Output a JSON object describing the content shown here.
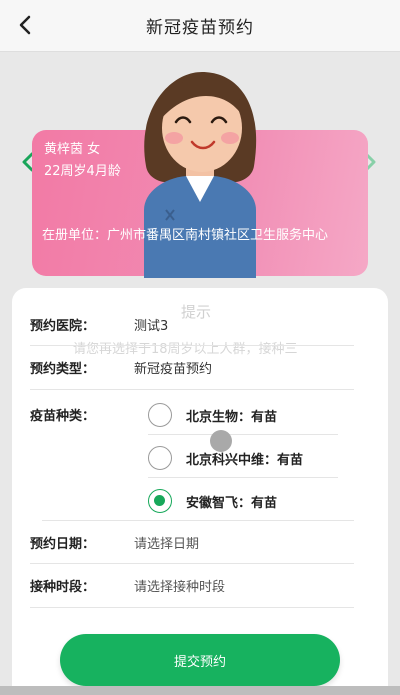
{
  "header": {
    "title": "新冠疫苗预约",
    "back_icon": "chevron-left-icon"
  },
  "patient": {
    "name_gender": "黄梓茵 女",
    "age": "22周岁4月龄",
    "unit": "在册单位：广州市番禺区南村镇社区卫生服务中心"
  },
  "overlay": {
    "title": "提示",
    "text": "请您再选择于18周岁以上人群，接种三"
  },
  "form": {
    "hospital": {
      "label": "预约医院：",
      "value": "测试3"
    },
    "type": {
      "label": "预约类型：",
      "value": "新冠疫苗预约"
    },
    "vaccine": {
      "label": "疫苗种类：",
      "options": [
        {
          "label": "北京生物：有苗",
          "checked": false
        },
        {
          "label": "北京科兴中维：有苗",
          "checked": false
        },
        {
          "label": "安徽智飞：有苗",
          "checked": true
        }
      ]
    },
    "date": {
      "label": "预约日期：",
      "value": "请选择日期"
    },
    "period": {
      "label": "接种时段：",
      "value": "请选择接种时段"
    }
  },
  "submit_label": "提交预约",
  "colors": {
    "accent": "#17b25f",
    "card": "#f27aa5"
  }
}
